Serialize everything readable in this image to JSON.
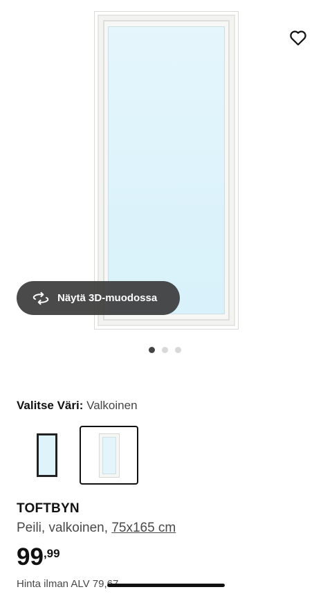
{
  "gallery": {
    "view_3d_label": "Näytä 3D-muodossa",
    "dots_total": 3,
    "dots_active_index": 0
  },
  "color_select": {
    "label": "Valitse Väri:",
    "selected_value": "Valkoinen",
    "options": [
      {
        "name": "Musta",
        "color": "#222222",
        "selected": false
      },
      {
        "name": "Valkoinen",
        "color": "#f6f6f4",
        "selected": true
      }
    ]
  },
  "product": {
    "name": "TOFTBYN",
    "description": "Peili, valkoinen,",
    "size": "75x165 cm",
    "price_int": "99",
    "price_sep": ",",
    "price_dec": "99",
    "vat_text": "Hinta ilman ALV 79,67"
  },
  "colors": {
    "pill_bg": "#3c3c3c",
    "accent_dark": "#111111"
  },
  "icons": [
    "heart-icon",
    "rotate-3d-icon"
  ]
}
